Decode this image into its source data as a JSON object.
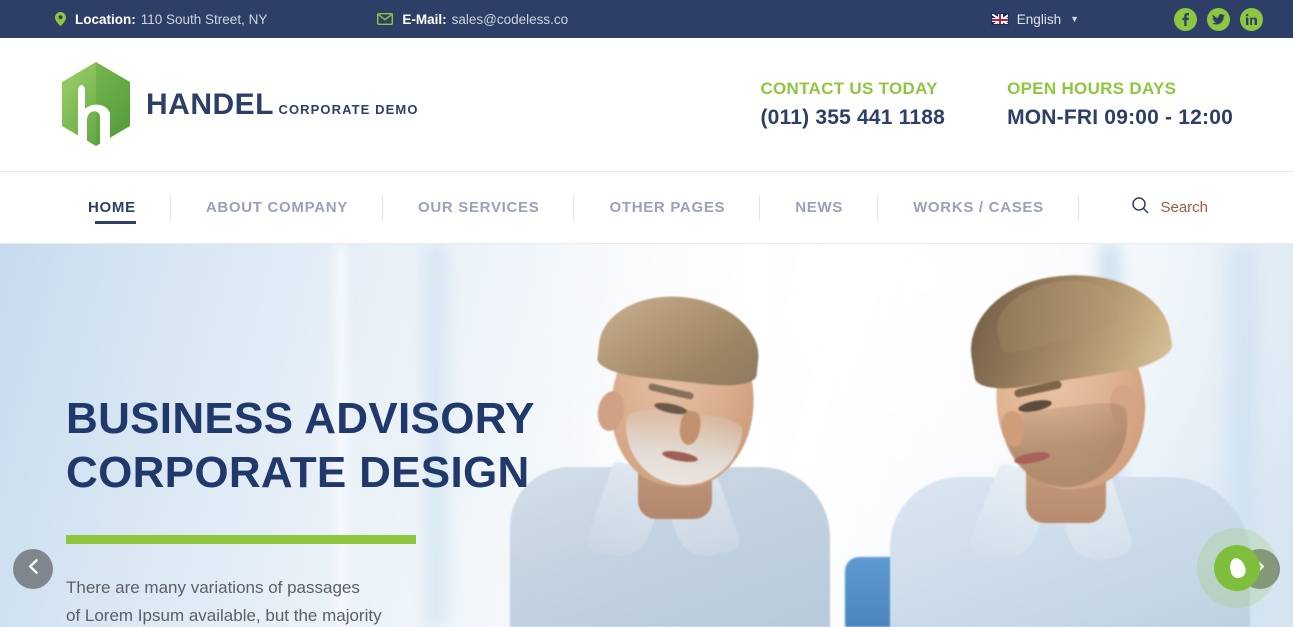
{
  "topbar": {
    "location": {
      "icon": "map-pin-icon",
      "label": "Location:",
      "value": "110 South Street, NY"
    },
    "email": {
      "icon": "envelope-icon",
      "label": "E-Mail:",
      "value": "sales@codeless.co"
    },
    "language": {
      "icon": "uk-flag-icon",
      "value": "English",
      "caret": "▼"
    },
    "social": [
      {
        "name": "facebook",
        "glyph": "f"
      },
      {
        "name": "twitter",
        "glyph": "t"
      },
      {
        "name": "linkedin",
        "glyph": "in"
      }
    ],
    "background_color": "#2d3f66"
  },
  "header": {
    "logo": {
      "brand": "HANDEL",
      "tagline": "CORPORATE DEMO",
      "icon": "hexagon-h-logo-icon"
    },
    "contact": {
      "title": "CONTACT US TODAY",
      "value": "(011) 355 441 1188"
    },
    "hours": {
      "title": "OPEN HOURS DAYS",
      "value": "MON-FRI 09:00 - 12:00"
    },
    "accent_color": "#8ec73f",
    "navy_color": "#2d3f66"
  },
  "nav": {
    "items": [
      {
        "label": "HOME",
        "active": true
      },
      {
        "label": "ABOUT COMPANY",
        "active": false
      },
      {
        "label": "OUR SERVICES",
        "active": false
      },
      {
        "label": "OTHER PAGES",
        "active": false
      },
      {
        "label": "NEWS",
        "active": false
      },
      {
        "label": "WORKS / CASES",
        "active": false
      }
    ],
    "search": {
      "icon": "search-icon",
      "label": "Search",
      "color": "#a05a44"
    }
  },
  "hero": {
    "title_line1": "BUSINESS ADVISORY",
    "title_line2": "CORPORATE DESIGN",
    "description_line1": "There are many variations of passages",
    "description_line2": "of Lorem Ipsum available, but the majority",
    "bar_color": "#8ec73f",
    "title_color": "#21386b",
    "prev_arrow": {
      "icon": "chevron-left-icon"
    },
    "next_arrow": {
      "icon": "chevron-right-icon"
    },
    "chat_widget": {
      "icon": "leaf-drop-icon",
      "color": "#7ebe3c"
    }
  }
}
